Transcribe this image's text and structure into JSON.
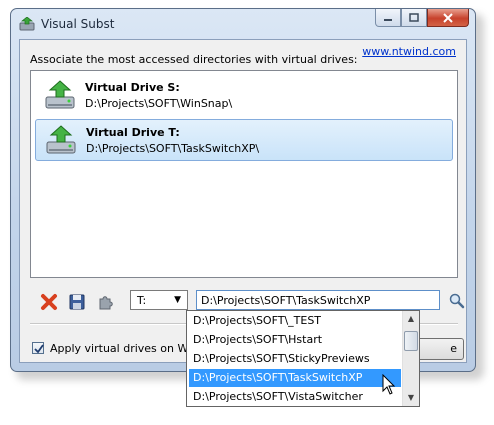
{
  "window": {
    "title": "Visual Subst"
  },
  "header": {
    "instruction": "Associate the most accessed directories with virtual drives:",
    "link": "www.ntwind.com"
  },
  "drives": [
    {
      "name": "Virtual Drive S:",
      "path": "D:\\Projects\\SOFT\\WinSnap\\",
      "selected": false
    },
    {
      "name": "Virtual Drive T:",
      "path": "D:\\Projects\\SOFT\\TaskSwitchXP\\",
      "selected": true
    }
  ],
  "toolbar": {
    "drive_letter": "T:",
    "path_value": "D:\\Projects\\SOFT\\TaskSwitchXP"
  },
  "dropdown_items": [
    {
      "label": "D:\\Projects\\SOFT\\_TEST",
      "highlighted": false
    },
    {
      "label": "D:\\Projects\\SOFT\\Hstart",
      "highlighted": false
    },
    {
      "label": "D:\\Projects\\SOFT\\StickyPreviews",
      "highlighted": false
    },
    {
      "label": "D:\\Projects\\SOFT\\TaskSwitchXP",
      "highlighted": true
    },
    {
      "label": "D:\\Projects\\SOFT\\VistaSwitcher",
      "highlighted": false
    }
  ],
  "footer": {
    "checkbox_label": "Apply virtual drives on Windo",
    "checkbox_checked": true,
    "button_label": "e"
  },
  "colors": {
    "selection": "#3399ff",
    "link": "#0033cc"
  }
}
